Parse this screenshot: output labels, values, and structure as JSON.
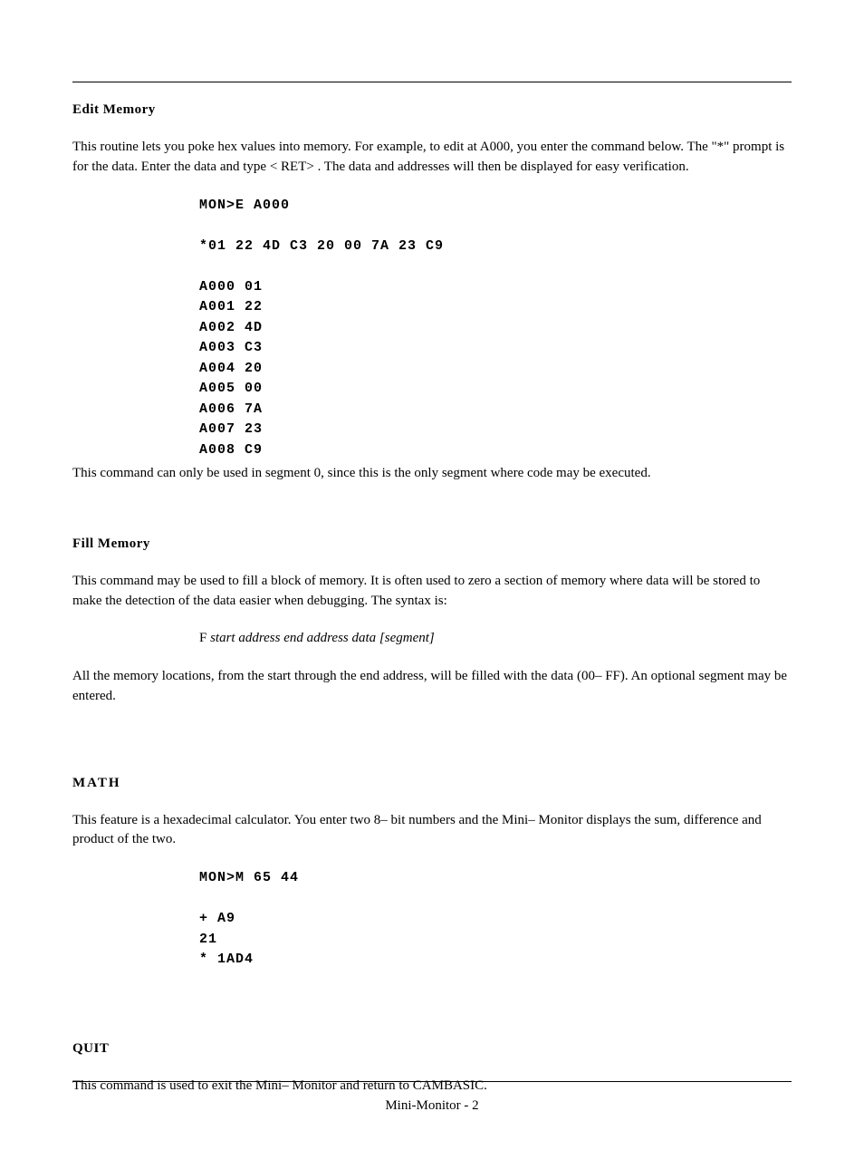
{
  "sections": {
    "editMemory": {
      "heading": "Edit Memory",
      "para1": "This routine lets you poke hex values into memory.  For example,  to edit at A000, you enter the command below.  The \"*\" prompt is for the data.  Enter the data and type < RET>  .  The data and addresses will then be displayed for easy verification.",
      "code": "MON>E A000\n\n*01 22 4D C3 20 00 7A 23 C9\n\nA000 01\nA001 22\nA002 4D\nA003 C3\nA004 20\nA005 00\nA006 7A\nA007 23\nA008 C9",
      "para2": "This command can only be used in segment 0,  since this is the only segment where code may be executed."
    },
    "fillMemory": {
      "heading": "Fill Memory",
      "para1": "This command may be used to fill a block of memory.  It is often used to zero a section of memory where data will be stored to make the detection of the data easier when debugging.  The syntax is:",
      "syntaxCmd": "F  ",
      "syntaxArgs": "start address  end address  data  [segment]",
      "para2": "All the memory locations, from the start through the end address, will be filled with the data (00– FF).  An optional segment may be entered."
    },
    "math": {
      "heading": "MATH",
      "para1": "This feature is a hexadecimal calculator.  You enter two 8– bit numbers and the Mini– Monitor displays the sum, difference and product of the two.",
      "code": "MON>M 65 44\n\n+ A9\n21\n* 1AD4"
    },
    "quit": {
      "heading": "QUIT",
      "para1": "This command is used to exit the Mini– Monitor and return to CAMBASIC."
    }
  },
  "footer": {
    "label": "Mini-Monitor - 2"
  }
}
